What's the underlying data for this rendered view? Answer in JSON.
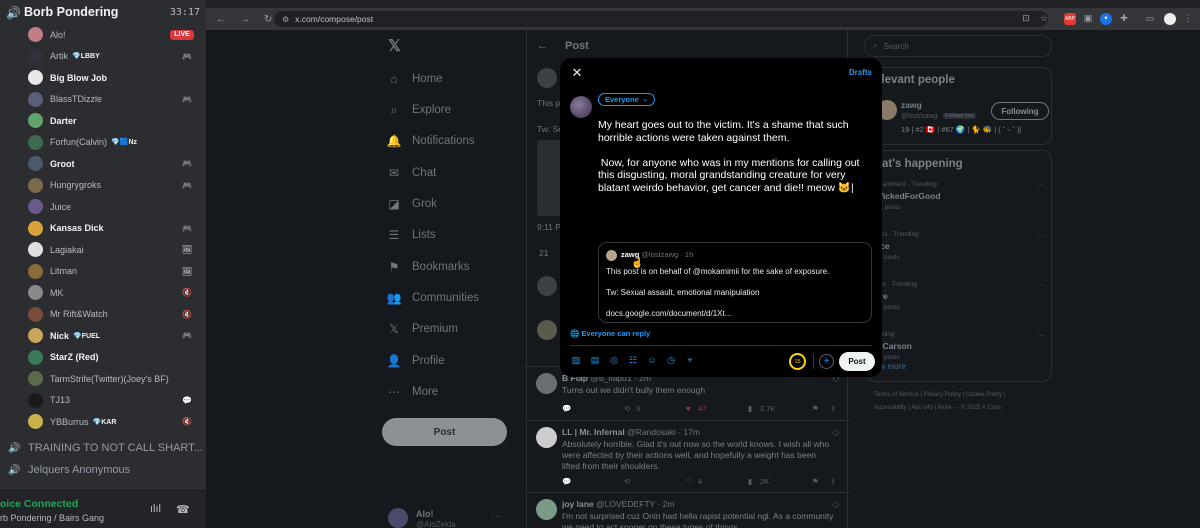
{
  "discord": {
    "channel_name": "Borb Pondering",
    "call_time": "33:17",
    "members": [
      {
        "name": "Alo!",
        "bold": false,
        "tag": "",
        "right": "LIVE",
        "color": "#c27d86"
      },
      {
        "name": "Artik",
        "bold": false,
        "tag": "💎LBBY",
        "right": "🎮",
        "color": "#30323a"
      },
      {
        "name": "Big Blow Job",
        "bold": true,
        "tag": "",
        "right": "",
        "color": "#e8e8e8"
      },
      {
        "name": "BlassTDizzle",
        "bold": false,
        "tag": "",
        "right": "🎮",
        "color": "#5a5e7a"
      },
      {
        "name": "Darter",
        "bold": true,
        "tag": "",
        "right": "",
        "color": "#5fa46b"
      },
      {
        "name": "Forfun(Calvin)",
        "bold": false,
        "tag": "💎🟦Nz",
        "right": "",
        "color": "#3e6a50"
      },
      {
        "name": "Groot",
        "bold": true,
        "tag": "",
        "right": "🎮",
        "color": "#4a5a6a"
      },
      {
        "name": "Hungrygroks",
        "bold": false,
        "tag": "",
        "right": "🎮",
        "color": "#7a6a4a"
      },
      {
        "name": "Juice",
        "bold": false,
        "tag": "",
        "right": "",
        "color": "#6b5b8a"
      },
      {
        "name": "Kansas Dick",
        "bold": true,
        "tag": "",
        "right": "🎮",
        "color": "#d9a23a"
      },
      {
        "name": "Lagiakai",
        "bold": false,
        "tag": "",
        "right": "🖼",
        "color": "#e0e0e0"
      },
      {
        "name": "Litman",
        "bold": false,
        "tag": "",
        "right": "🖼",
        "color": "#8a6a3a"
      },
      {
        "name": "MK",
        "bold": false,
        "tag": "",
        "right": "🔇",
        "color": "#8a8a8a"
      },
      {
        "name": "Mr Rift&Watch",
        "bold": false,
        "tag": "",
        "right": "🔇",
        "color": "#7a4a3a"
      },
      {
        "name": "Nick",
        "bold": true,
        "tag": "💎FUEL",
        "right": "🎮",
        "color": "#c9a45a"
      },
      {
        "name": "StarZ (Red)",
        "bold": true,
        "tag": "",
        "right": "",
        "color": "#3a7a5a"
      },
      {
        "name": "TarmStrife(Twitter)(Joey's BF)",
        "bold": false,
        "tag": "",
        "right": "",
        "color": "#5a6a4a"
      },
      {
        "name": "TJ13",
        "bold": false,
        "tag": "",
        "right": "💬",
        "color": "#1a1a1a"
      },
      {
        "name": "YBBurrus",
        "bold": false,
        "tag": "💎KAR",
        "right": "🔇",
        "color": "#c9b24a"
      }
    ],
    "other_channels": [
      "TRAINING TO NOT CALL SHART...",
      "Jelquers Anonymous"
    ],
    "voice_status": "oice Connected",
    "voice_location": "rb Pondering / Bairs Gang"
  },
  "browser": {
    "url": "x.com/compose/post"
  },
  "x": {
    "nav": [
      {
        "icon": "⌂",
        "label": "Home"
      },
      {
        "icon": "⌕",
        "label": "Explore"
      },
      {
        "icon": "🔔",
        "label": "Notifications"
      },
      {
        "icon": "✉",
        "label": "Chat"
      },
      {
        "icon": "◪",
        "label": "Grok"
      },
      {
        "icon": "☰",
        "label": "Lists"
      },
      {
        "icon": "⚑",
        "label": "Bookmarks"
      },
      {
        "icon": "👥",
        "label": "Communities"
      },
      {
        "icon": "𝕏",
        "label": "Premium"
      },
      {
        "icon": "👤",
        "label": "Profile"
      },
      {
        "icon": "⋯",
        "label": "More"
      }
    ],
    "post_button": "Post",
    "account": {
      "name": "Alo!",
      "handle": "@AloZelda"
    },
    "feed_title": "Post",
    "bg_snippets": {
      "s1": "This po",
      "s2": "Tw: Se",
      "s3": "9:11 PM",
      "s4": "21"
    },
    "tweets": [
      {
        "name": "B Flap",
        "handle": "@b_flap01 · 2m",
        "body": "Turns out we didn't bully them enough",
        "replies": "",
        "reposts": "3",
        "likes": "47",
        "views": "2.7K"
      },
      {
        "name": "LL | Mr. Infernal",
        "handle": "@Randosaki · 17m",
        "body": "Absolutely horrible. Glad it's out now so the world knows. I wish all who were affected by their actions well, and hopefully a weight has been lifted from their shoulders.",
        "replies": "",
        "reposts": "",
        "likes": "4",
        "views": "2K"
      },
      {
        "name": "joy lane",
        "handle": "@LOVEDEFTY · 2m",
        "body": "I'm not surprised cuz Onin had hella rapist potential ngl. As a community we need to act sooner on these types of things",
        "replies": "",
        "reposts": "",
        "likes": "",
        "views": ""
      }
    ],
    "search_placeholder": "Search",
    "relevant_title": "elevant people",
    "relevant_person": {
      "name": "zawg",
      "handle": "@lost/zawg",
      "follows_you": "Follows you",
      "bio": "19 | #2 🇨🇦 | #67 🌍 | 🐈 🐝 | ( ˘ ᵕ ˘ )ʃ",
      "button": "Following"
    },
    "happening_title": "hat's happening",
    "trends": [
      {
        "cat": "ertainment · Trending",
        "name": "WickedForGood",
        "posts": "9K posts"
      },
      {
        "cat": "litics · Trending",
        "name": "nce",
        "posts": "34 posts"
      },
      {
        "cat": "orts · Trending",
        "name": "are",
        "posts": "76 posts"
      },
      {
        "cat": "ending",
        "name": "n Carson",
        "posts": "73 posts"
      }
    ],
    "show_more": "ow more",
    "footer": {
      "l1": "Terms of Service  |  Privacy Policy  |  Cookie Policy  |",
      "l2": "Accessibility  |  Ads info  |  More ···  © 2025 X Corp."
    }
  },
  "modal": {
    "drafts": "Drafts",
    "audience": "Everyone",
    "text": "My heart goes out to the victim. It's a shame that such horrible actions were taken against them.\n\n Now, for anyone who was in my mentions for calling out this disgusting, moral grandstanding creature for very blatant weirdo behavior, get cancer and die!! meow 🐱|",
    "quote": {
      "name": "zawg",
      "handle": "@lostzawg · 1h",
      "line1": "This post is on behalf of @mokamimii for the sake of exposure.",
      "line2": "Tw: Sexual assault, emotional manipulation",
      "line3": "docs.google.com/document/d/1Xt..."
    },
    "reply_setting": "🌐 Everyone can reply",
    "char_counter": "15",
    "post_label": "Post"
  }
}
